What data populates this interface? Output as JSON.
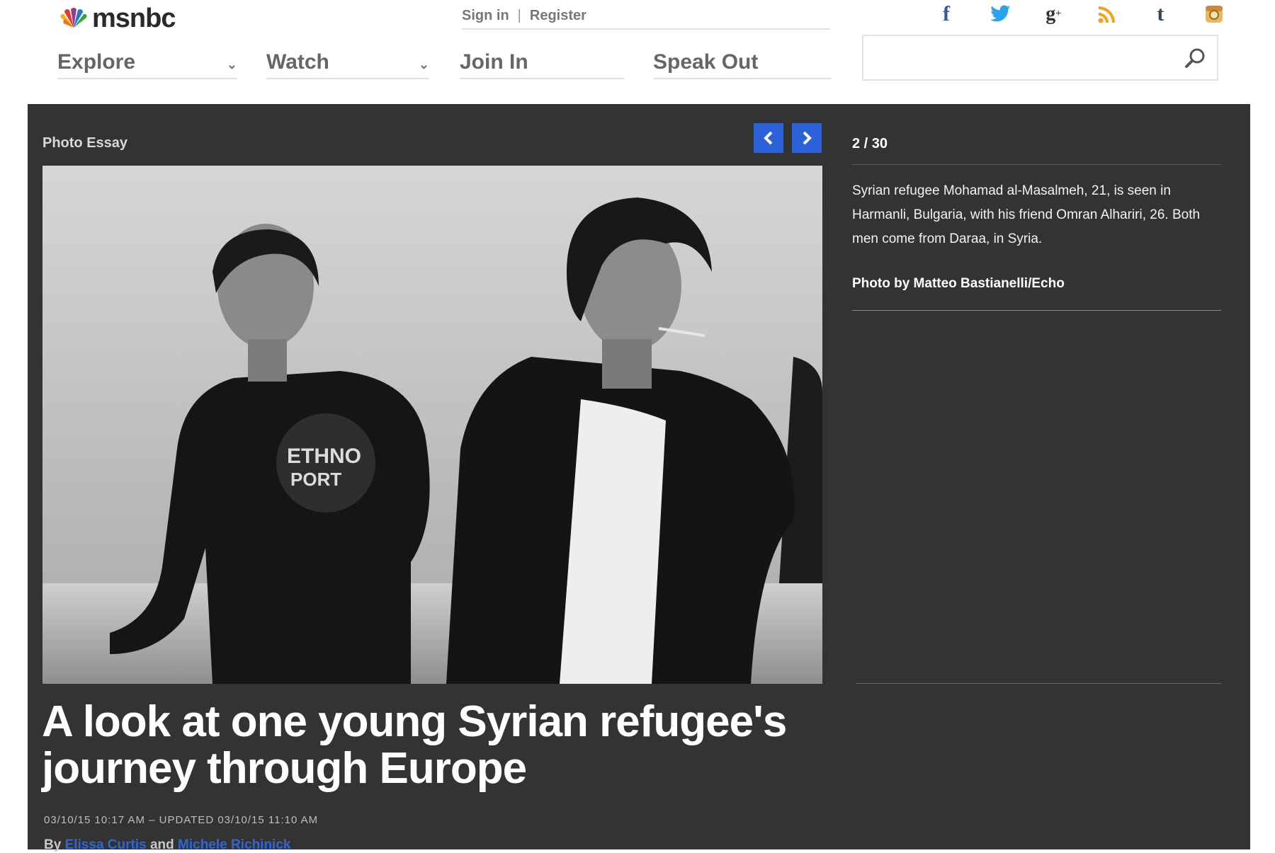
{
  "brand": {
    "name": "msnbc"
  },
  "account": {
    "sign_in": "Sign in",
    "separator": "|",
    "register": "Register"
  },
  "nav": {
    "explore": "Explore",
    "watch": "Watch",
    "join_in": "Join In",
    "speak_out": "Speak Out"
  },
  "social": [
    "facebook-icon",
    "twitter-icon",
    "google-plus-icon",
    "rss-icon",
    "tumblr-icon",
    "instagram-icon"
  ],
  "search": {
    "placeholder": ""
  },
  "gallery": {
    "section_label": "Photo Essay",
    "counter": "2 / 30",
    "caption": "Syrian refugee Mohamad al-Masalmeh, 21, is seen in Harmanli, Bulgaria, with his friend Omran Alhariri, 26. Both men come from Daraa, in Syria.",
    "credit": "Photo by Matteo Bastianelli/Echo"
  },
  "article": {
    "headline": "A look at one young Syrian refugee's journey through Europe",
    "timestamp": "03/10/15 10:17 AM – UPDATED 03/10/15 11:10 AM",
    "by": "By",
    "and": "and",
    "authors": [
      "Elissa Curtis",
      "Michele Richinick"
    ]
  },
  "colors": {
    "panel": "#333333",
    "accent_blue": "#2c62d9",
    "facebook": "#3b5998",
    "twitter": "#2aa3ef",
    "rss": "#f7a11b",
    "tumblr": "#36465d",
    "instagram": "#e9b95b"
  }
}
